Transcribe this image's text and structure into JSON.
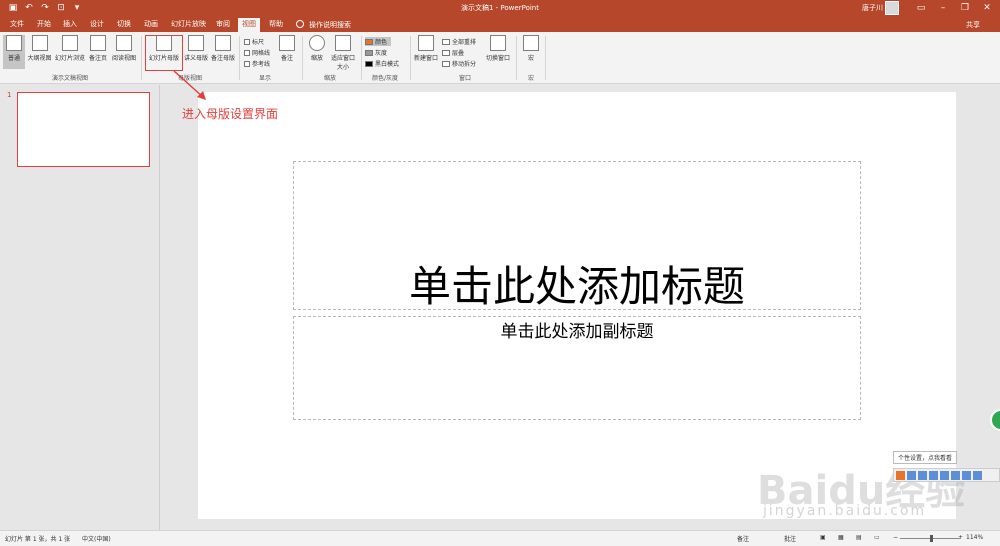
{
  "window": {
    "title": "演示文稿1 - PowerPoint",
    "user": "唐子川"
  },
  "tabs": [
    "文件",
    "开始",
    "插入",
    "设计",
    "切换",
    "动画",
    "幻灯片放映",
    "审阅",
    "视图",
    "帮助"
  ],
  "search_tip": "操作说明搜索",
  "share": "共享",
  "ribbon": {
    "views": {
      "normal": "普通",
      "outline": "大纲视图",
      "sorter": "幻灯片浏览",
      "notes_page": "备注页",
      "reading": "阅读视图",
      "group": "演示文稿视图"
    },
    "master": {
      "slide_master": "幻灯片母版",
      "handout_master": "讲义母版",
      "notes_master": "备注母版",
      "group": "母版视图"
    },
    "show": {
      "ruler": "标尺",
      "gridlines": "网格线",
      "guides": "参考线",
      "notes": "备注",
      "group": "显示"
    },
    "zoom": {
      "zoom": "缩放",
      "fit": "适应窗口大小",
      "group": "缩放"
    },
    "color": {
      "color": "颜色",
      "grayscale": "灰度",
      "bw": "黑白模式",
      "group": "颜色/灰度"
    },
    "window": {
      "new_window": "新建窗口",
      "arrange_all": "全部重排",
      "cascade": "层叠",
      "move_split": "移动拆分",
      "switch": "切换窗口",
      "group": "窗口"
    },
    "macro": {
      "macro": "宏",
      "group": "宏"
    }
  },
  "slide_number": "1",
  "annotation": "进入母版设置界面",
  "slide": {
    "title": "单击此处添加标题",
    "subtitle": "单击此处添加副标题"
  },
  "tooltip": "个性设置，点我看看",
  "watermark": "Baidu经验",
  "watermark_sub": "jingyan.baidu.com",
  "status": {
    "slide_info": "幻灯片 第 1 张，共 1 张",
    "language": "中文(中国)",
    "notes": "备注",
    "comments": "批注",
    "zoom": "114%"
  },
  "colors": {
    "accent": "#b7472a",
    "highlight": "#e0413e"
  }
}
